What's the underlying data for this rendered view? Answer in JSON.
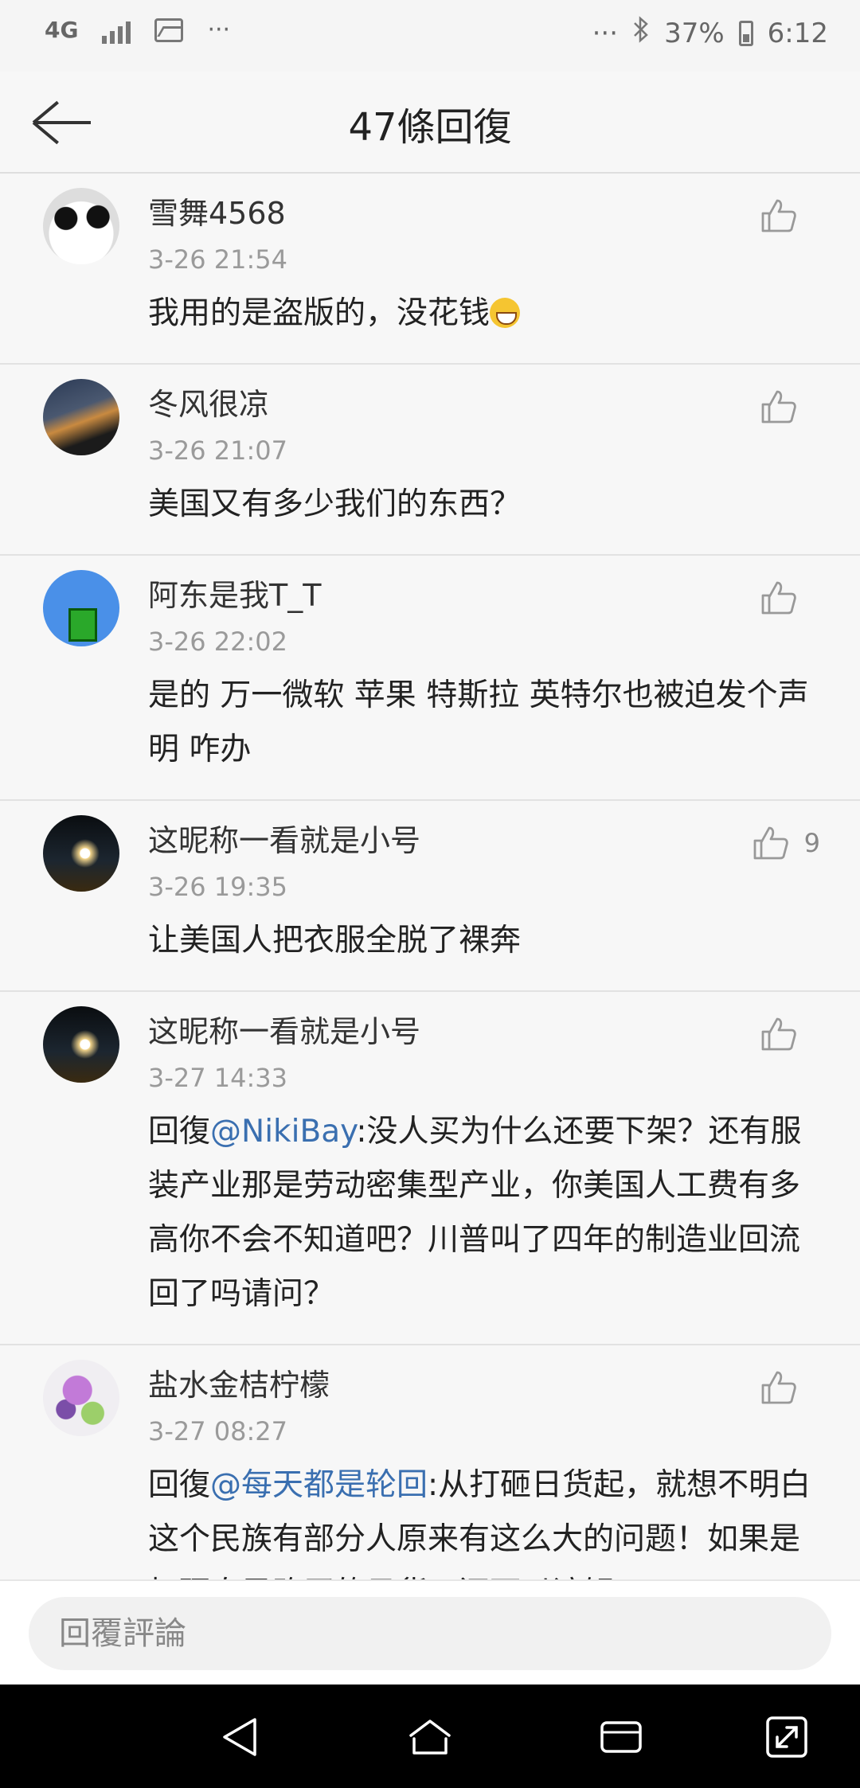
{
  "status_bar": {
    "network": "4G",
    "more": "···",
    "more_right": "···",
    "battery": "37%",
    "time": "6:12"
  },
  "header": {
    "title": "47條回復"
  },
  "comments": [
    {
      "name": "雪舞4568",
      "time": "3-26 21:54",
      "text": "我用的是盗版的，没花钱",
      "likes": ""
    },
    {
      "name": "冬风很凉",
      "time": "3-26 21:07",
      "text": "美国又有多少我们的东西？",
      "likes": ""
    },
    {
      "name": "阿东是我T_T",
      "time": "3-26 22:02",
      "text": "是的 万一微软 苹果 特斯拉 英特尔也被迫发个声明 咋办",
      "likes": ""
    },
    {
      "name": "这昵称一看就是小号",
      "time": "3-26 19:35",
      "text": "让美国人把衣服全脱了裸奔",
      "likes": "9"
    },
    {
      "name": "这昵称一看就是小号",
      "time": "3-27 14:33",
      "reply_prefix": "回復",
      "mention": "@NikiBay",
      "text": ":没人买为什么还要下架？还有服装产业那是劳动密集型产业，你美国人工费有多高你不会不知道吧？川普叫了四年的制造业回流回了吗请问？",
      "likes": ""
    },
    {
      "name": "盐水金桔柠檬",
      "time": "3-27 08:27",
      "reply_prefix": "回復",
      "mention": "@每天都是轮回",
      "text": ":从打砸日货起，就想不明白这个民族有部分人原来有这么大的问题！如果是打砸自己购买的日货，还可以谅解！",
      "likes": ""
    }
  ],
  "reply_bar": {
    "placeholder": "回覆評論"
  }
}
